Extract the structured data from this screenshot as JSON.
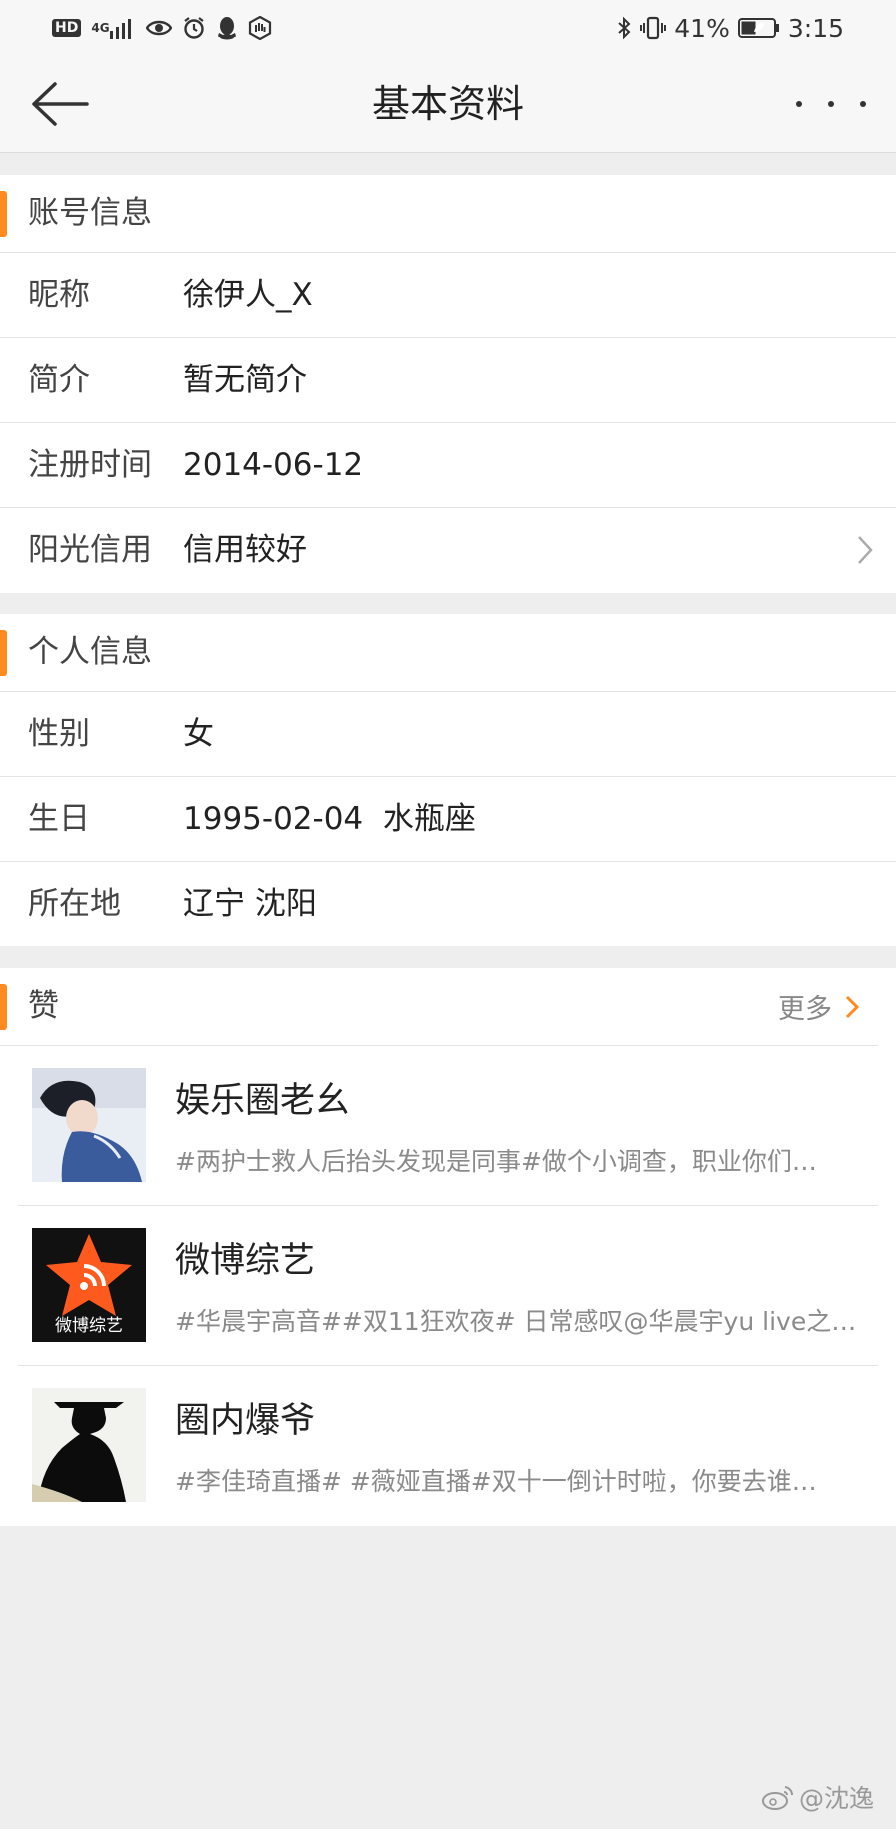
{
  "status_bar": {
    "hd": "HD",
    "network": "4G",
    "battery_percent": "41%",
    "time": "3:15"
  },
  "header": {
    "title": "基本资料"
  },
  "account_section": {
    "title": "账号信息",
    "rows": [
      {
        "key": "昵称",
        "value": "徐伊人_X"
      },
      {
        "key": "简介",
        "value": "暂无简介"
      },
      {
        "key": "注册时间",
        "value": "2014-06-12"
      },
      {
        "key": "阳光信用",
        "value": "信用较好"
      }
    ]
  },
  "personal_section": {
    "title": "个人信息",
    "rows": [
      {
        "key": "性别",
        "value": "女"
      },
      {
        "key": "生日",
        "value": "1995-02-04  水瓶座"
      },
      {
        "key": "所在地",
        "value": "辽宁 沈阳"
      }
    ]
  },
  "likes_section": {
    "title": "赞",
    "more_label": "更多",
    "items": [
      {
        "name": "娱乐圈老幺",
        "desc": "#两护士救人后抬头发现是同事#做个小调查，职业你们…",
        "avatar_text": ""
      },
      {
        "name": "微博综艺",
        "desc": "#华晨宇高音##双11狂欢夜# 日常感叹@华晨宇yu live之…",
        "avatar_text": "微博综艺"
      },
      {
        "name": "圈内爆爷",
        "desc": "#李佳琦直播# #薇娅直播#双十一倒计时啦，你要去谁…",
        "avatar_text": ""
      }
    ]
  },
  "watermark": {
    "text": "@沈逸"
  },
  "colors": {
    "accent": "#ff8a1f",
    "background": "#eeeeee",
    "card": "#ffffff"
  }
}
